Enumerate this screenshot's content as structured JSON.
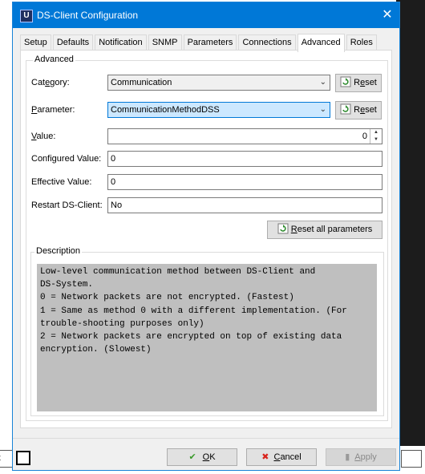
{
  "background": {
    "bottom_left_text": "t"
  },
  "window": {
    "title": "DS-Client Configuration",
    "icon_letter": "U",
    "close_glyph": "✕"
  },
  "tabs": [
    {
      "label": "Setup"
    },
    {
      "label": "Defaults"
    },
    {
      "label": "Notification"
    },
    {
      "label": "SNMP"
    },
    {
      "label": "Parameters"
    },
    {
      "label": "Connections"
    },
    {
      "label": "Advanced",
      "active": true
    },
    {
      "label": "Roles"
    }
  ],
  "advanced": {
    "group_title": "Advanced",
    "category_label_pre": "Cat",
    "category_label_u": "e",
    "category_label_post": "gory:",
    "category_value": "Communication",
    "parameter_label_u": "P",
    "parameter_label_post": "arameter:",
    "parameter_value": "CommunicationMethodDSS",
    "value_label_u": "V",
    "value_label_post": "alue:",
    "value_value": "0",
    "configured_label": "Configured Value:",
    "configured_value": "0",
    "effective_label": "Effective Value:",
    "effective_value": "0",
    "restart_label": "Restart DS-Client:",
    "restart_value": "No",
    "reset_pre": "R",
    "reset_u": "e",
    "reset_post": "set",
    "reset_all_u": "R",
    "reset_all_post": "eset all parameters"
  },
  "description": {
    "title": "Description",
    "text": "Low-level communication method between DS-Client and\nDS-System.\n0 = Network packets are not encrypted. (Fastest)\n1 = Same as method 0 with a different implementation. (For\ntrouble-shooting purposes only)\n2 = Network packets are encrypted on top of existing data\nencryption. (Slowest)"
  },
  "footer": {
    "ok_u": "O",
    "ok_post": "K",
    "cancel_u": "C",
    "cancel_post": "ancel",
    "apply_u": "A",
    "apply_post": "pply"
  },
  "colors": {
    "titlebar": "#0078d7",
    "focused_field": "#cce8ff",
    "description_bg": "#bfbfbf",
    "ok_check": "#3a9a2a",
    "cancel_x": "#d9231c"
  }
}
